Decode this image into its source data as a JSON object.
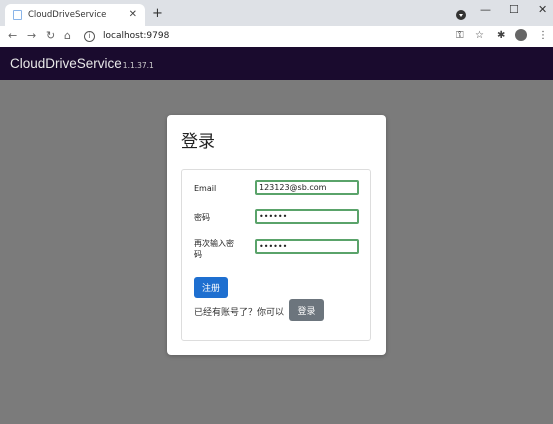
{
  "browser": {
    "tab_title": "CloudDriveService",
    "close_tab": "✕",
    "new_tab": "+",
    "url": "localhost:9798",
    "window_buttons": [
      "—",
      "☐",
      "✕"
    ]
  },
  "app": {
    "brand": "CloudDriveService",
    "version": "1.1.37.1"
  },
  "modal": {
    "title": "登录",
    "form": {
      "email_label": "Email",
      "email_value": "123123@sb.com",
      "password_label": "密码",
      "password_value": "••••••",
      "confirm_label": "再次输入密码",
      "confirm_value": "••••••",
      "register_button": "注册",
      "hint_text": "已经有账号了？你可以",
      "login_button": "登录"
    }
  }
}
